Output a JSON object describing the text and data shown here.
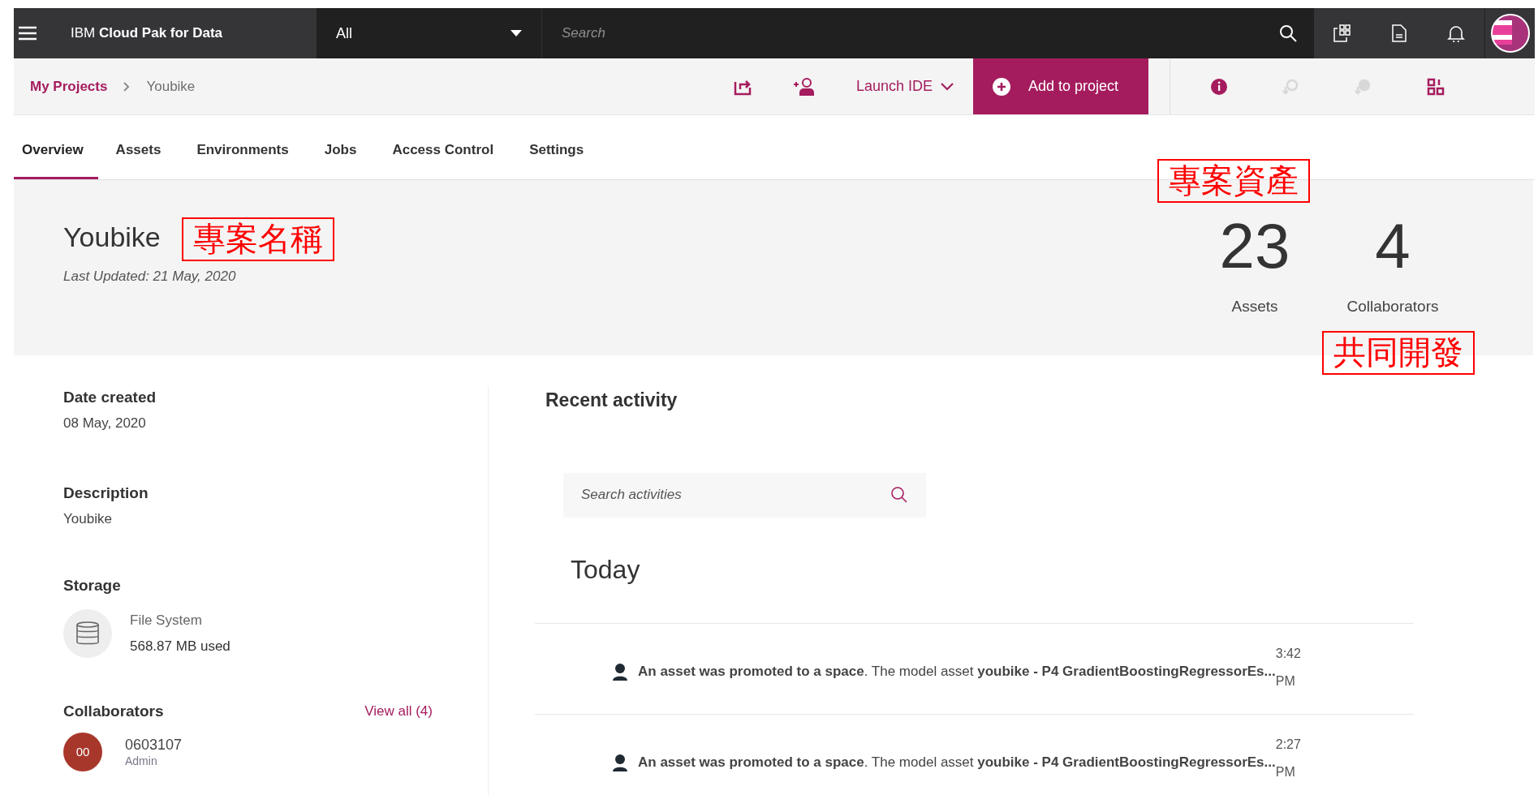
{
  "top_bar": {
    "brand_prefix": "IBM",
    "brand": "Cloud Pak for Data",
    "scope": "All",
    "search": {
      "placeholder": "Search"
    }
  },
  "breadcrumb": [
    {
      "label": "My Projects",
      "link": true
    },
    {
      "label": "Youbike",
      "link": false
    }
  ],
  "toolbar": {
    "launch": "Launch IDE",
    "add": "Add to project",
    "icons": [
      {
        "disabled": false
      },
      {
        "disabled": true
      },
      {
        "disabled": true
      },
      {
        "disabled": false
      }
    ]
  },
  "tabs": [
    {
      "label": "Overview",
      "selected": true
    },
    {
      "label": "Assets",
      "selected": false
    },
    {
      "label": "Environments",
      "selected": false
    },
    {
      "label": "Jobs",
      "selected": false
    },
    {
      "label": "Access Control",
      "selected": false
    },
    {
      "label": "Settings",
      "selected": false
    }
  ],
  "project": {
    "name": "Youbike",
    "updated_label": "Last Updated:",
    "updated": "21 May, 2020",
    "annotation": "專案名稱"
  },
  "stats": [
    {
      "value": "23",
      "label": "Assets",
      "annotation": "專案資產"
    },
    {
      "value": "4",
      "label": "Collaborators",
      "annotation": "共同開發"
    }
  ],
  "details": {
    "date_label": "Date created",
    "date": "08 May, 2020",
    "description_label": "Description",
    "description": "Youbike",
    "storage_label": "Storage",
    "storage_type": "File System",
    "storage_used": "568.87 MB used"
  },
  "collaborators": {
    "title": "Collaborators",
    "view_all": "View all (4)",
    "people": [
      {
        "initials": "00",
        "name": "0603107",
        "role": "Admin",
        "color": "#a8372b"
      }
    ]
  },
  "activity": {
    "title": "Recent activity",
    "search": {
      "placeholder": "Search activities"
    },
    "group": "Today",
    "items": [
      {
        "text": "**An asset was promoted to a space**. The model asset **youbike - P4 GradientBoostingRegressorEs...**",
        "time": "3:42 PM"
      },
      {
        "text": "**An asset was promoted to a space**. The model asset **youbike - P4 GradientBoostingRegressorEs...**",
        "time": "2:27 PM"
      }
    ]
  }
}
